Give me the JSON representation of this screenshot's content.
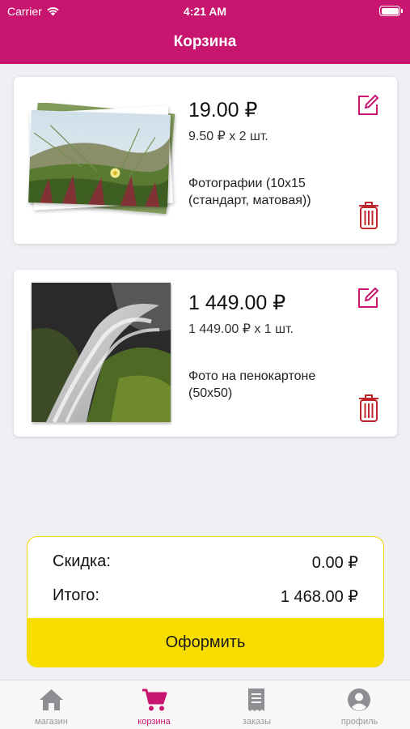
{
  "status_bar": {
    "carrier": "Carrier",
    "time": "4:21 AM"
  },
  "header": {
    "title": "Корзина"
  },
  "cart": {
    "items": [
      {
        "price": "19.00 ₽",
        "calc": "9.50 ₽ x 2 шт.",
        "description": "Фотографии (10x15 (стандарт, матовая))"
      },
      {
        "price": "1 449.00 ₽",
        "calc": "1 449.00 ₽ x 1 шт.",
        "description": "Фото на пенокартоне (50x50)"
      }
    ]
  },
  "summary": {
    "discount_label": "Скидка:",
    "discount_value": "0.00 ₽",
    "total_label": "Итого:",
    "total_value": "1 468.00 ₽",
    "checkout_label": "Оформить"
  },
  "tabbar": {
    "tabs": [
      {
        "label": "магазин",
        "icon": "home-icon"
      },
      {
        "label": "корзина",
        "icon": "cart-icon",
        "active": true
      },
      {
        "label": "заказы",
        "icon": "receipt-icon"
      },
      {
        "label": "профиль",
        "icon": "profile-icon"
      }
    ]
  },
  "colors": {
    "brand": "#c8156f",
    "accent": "#f8dd00",
    "delete": "#c0252b",
    "background": "#efeff4"
  }
}
